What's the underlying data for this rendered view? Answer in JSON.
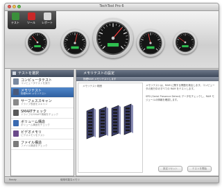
{
  "window": {
    "title": "TechTool Pro 6",
    "colors": {
      "close": "#ec5f57",
      "minimize": "#f5bf4f",
      "zoom": "#62c655",
      "header": "#3f4a5c",
      "selection": "#2f5f9f"
    }
  },
  "toolbar": {
    "buttons": [
      {
        "label": "テスト",
        "icon": "test-icon",
        "color": "#3a8f3a"
      },
      {
        "label": "ツール",
        "icon": "tools-icon",
        "color": "#c82828"
      },
      {
        "label": "レポート",
        "icon": "report-icon",
        "color": "#d8d8d8"
      }
    ]
  },
  "gauges": [
    {
      "name": "gauge-1",
      "icon": "gauge-icon",
      "level": 0.35
    },
    {
      "name": "gauge-2",
      "icon": "gauge-icon",
      "level": 0.55
    },
    {
      "name": "gauge-main",
      "icon": "gauge-icon",
      "level": 0.65
    },
    {
      "name": "gauge-4",
      "icon": "gauge-icon",
      "level": 0.45
    },
    {
      "name": "gauge-5",
      "icon": "gauge-icon",
      "level": 0.3
    }
  ],
  "left_panel": {
    "title": "テストを選択",
    "items": [
      {
        "title": "コンピュータテスト",
        "subtitle": "コンピュータテストを実行",
        "icon": "computer-icon",
        "color": "#7a8aa0",
        "selected": false
      },
      {
        "title": "メモリテスト",
        "subtitle": "物理RAM メモリテスト",
        "icon": "memory-icon",
        "color": "#4a5a7a",
        "selected": true
      },
      {
        "title": "サーフェススキャン",
        "subtitle": "ドライブ表面をスキャン",
        "icon": "drive-icon",
        "color": "#8a8a8a",
        "selected": false
      },
      {
        "title": "SMARTチェック",
        "subtitle": "ドライブのSMART情報をチェック",
        "icon": "smart-icon",
        "color": "#5a5a5a",
        "selected": false
      },
      {
        "title": "ボリューム構造",
        "subtitle": "ボリューム構造をチェック",
        "icon": "volume-icon",
        "color": "#3a6ab0",
        "selected": false
      },
      {
        "title": "ビデオメモリ",
        "subtitle": "ビデオメモリをテスト",
        "icon": "video-icon",
        "color": "#6a4a8a",
        "selected": false
      },
      {
        "title": "ファイル構造",
        "subtitle": "ファイル構造をチェック",
        "icon": "file-icon",
        "color": "#7a7a7a",
        "selected": false
      }
    ]
  },
  "right_panel": {
    "title": "メモリテストの設定",
    "subtitle": "物理RAM メモリテストします",
    "area_label": "メモリテスト範囲",
    "text1": "メモリテストは、RAM に関する問題を検出します。コンピュータの実行中のすべての RAM をテストします。",
    "text2": "SPD (Serial Presence Detect) データをチェックし、RAM モジュールの情報を確認します。",
    "button_left": "設定リセット",
    "button_right": "テストを開始"
  },
  "status": {
    "left": "Ready",
    "center": "使用可能なメモリ"
  }
}
